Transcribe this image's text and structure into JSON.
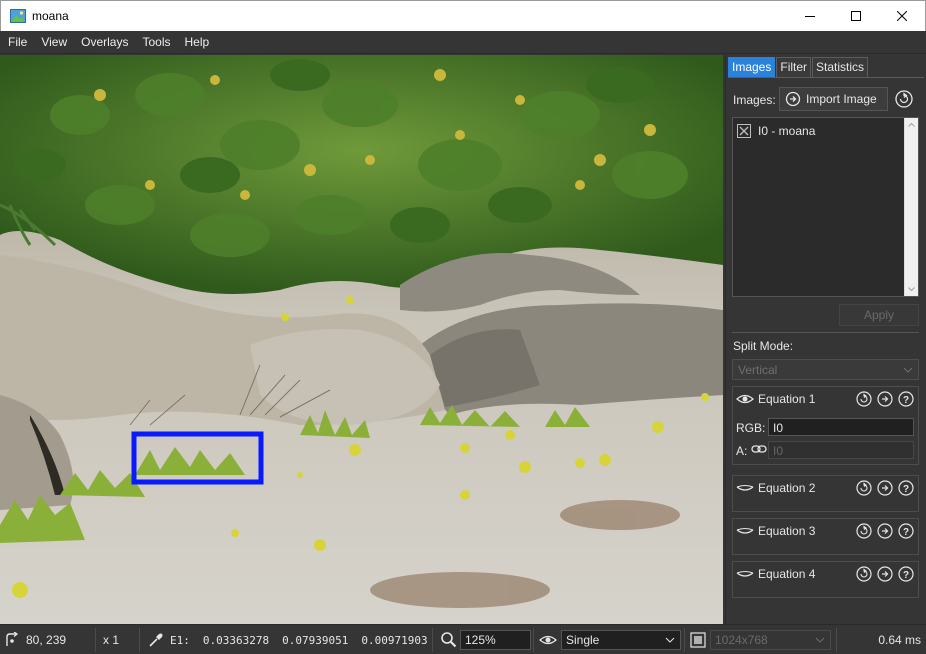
{
  "window": {
    "title": "moana",
    "icons": {
      "app": "image-app-icon",
      "minimize": "minimize-icon",
      "maximize": "maximize-icon",
      "close": "close-icon"
    }
  },
  "menubar": [
    "File",
    "View",
    "Overlays",
    "Tools",
    "Help"
  ],
  "panel": {
    "tabs": [
      "Images",
      "Filter",
      "Statistics"
    ],
    "active_tab": "Images",
    "images_label": "Images:",
    "import_button": "Import Image",
    "image_list": [
      {
        "label": "I0 - moana",
        "icon": "image-close-icon"
      }
    ],
    "apply_button": "Apply",
    "split_mode_label": "Split Mode:",
    "split_mode_value": "Vertical",
    "equations": [
      {
        "label": "Equation 1",
        "expanded": true,
        "rgb_label": "RGB:",
        "rgb_value": "I0",
        "alpha_label": "A:",
        "alpha_placeholder": "I0"
      },
      {
        "label": "Equation 2",
        "expanded": false
      },
      {
        "label": "Equation 3",
        "expanded": false
      },
      {
        "label": "Equation 4",
        "expanded": false
      }
    ]
  },
  "statusbar": {
    "cursor": "80, 239",
    "multiplier": "x 1",
    "equation_label": "E1:",
    "pixel_values": [
      "0.03363278",
      "0.07939051",
      "0.00971903"
    ],
    "zoom": "125%",
    "display_mode": "Single",
    "resolution": "1024x768",
    "render_time": "0.64 ms"
  },
  "colors": {
    "accent": "#2a82da",
    "selection_box": "#0a1aff",
    "panel_bg": "#353535"
  }
}
